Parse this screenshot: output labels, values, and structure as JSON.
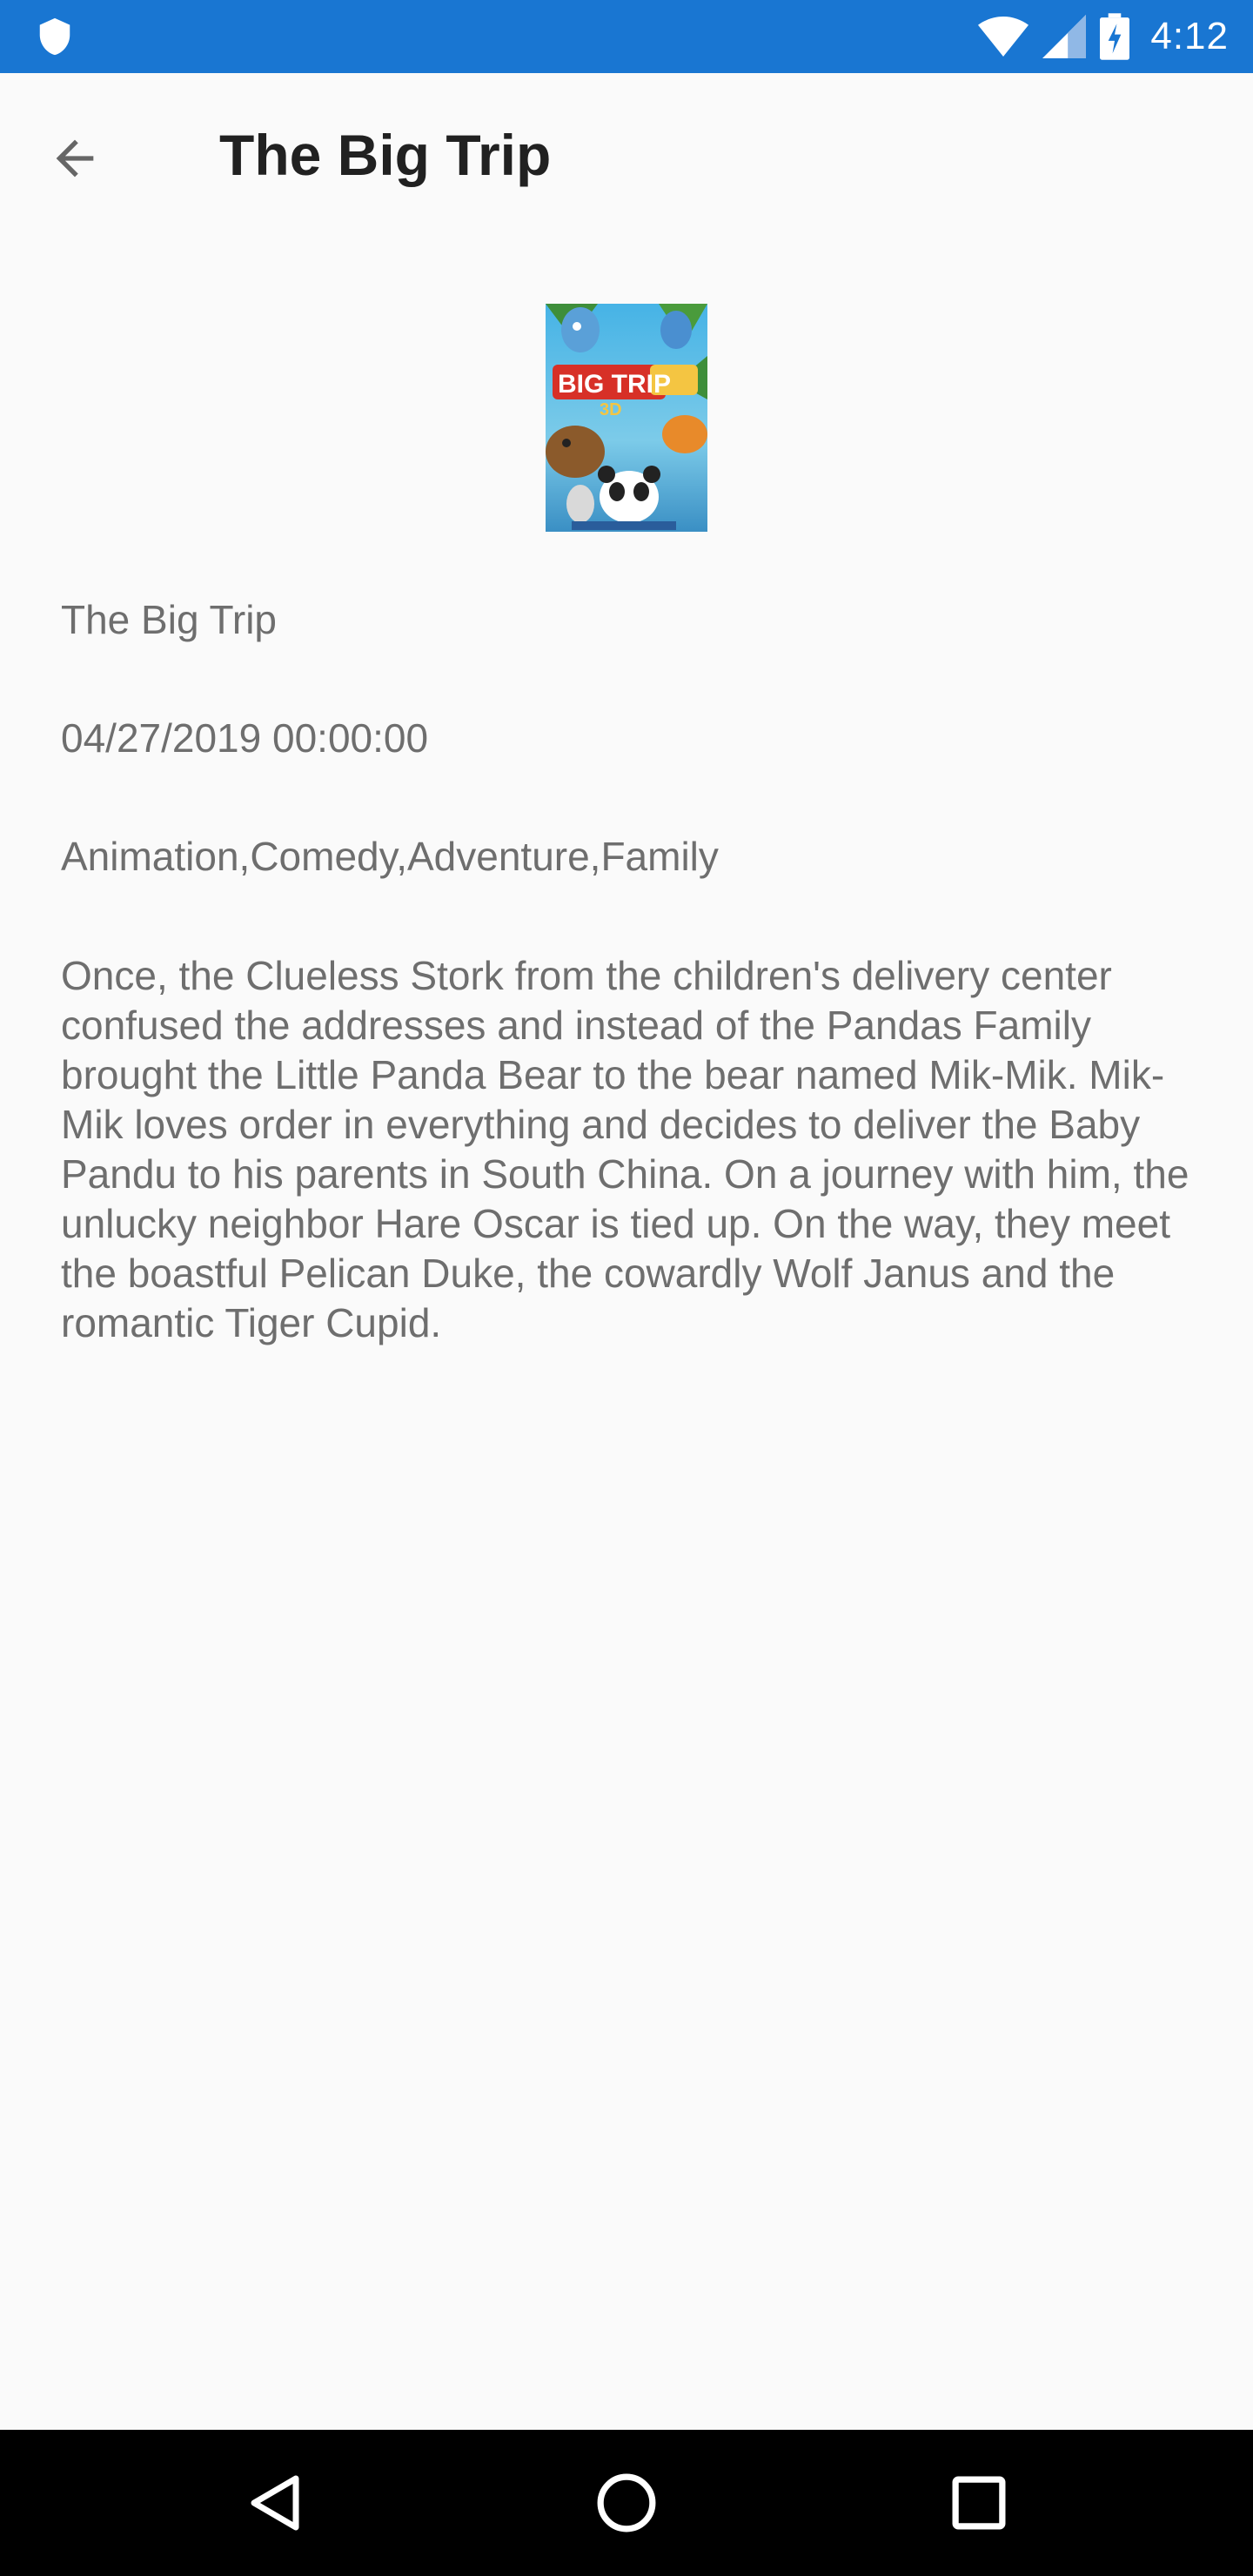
{
  "status_bar": {
    "time": "4:12",
    "icons": [
      "shield-icon",
      "wifi-icon",
      "cell-signal-icon",
      "battery-charging-icon"
    ],
    "background": "#1976d2"
  },
  "app_bar": {
    "title": "The Big Trip",
    "back_icon": "arrow-back-icon"
  },
  "movie": {
    "poster_alt": "movie-poster",
    "title": "The Big Trip",
    "release_date": "04/27/2019 00:00:00",
    "genres": "Animation,Comedy,Adventure,Family",
    "overview": "Once, the Clueless Stork from the children's delivery center confused the addresses and instead of the Pandas Family brought the Little Panda Bear to the bear named Mik-Mik. Mik-Mik loves order in everything and decides to deliver the Baby Pandu to his parents in South China. On a journey with him, the unlucky neighbor Hare Oscar is tied up. On the way, they meet the boastful Pelican Duke, the cowardly Wolf Janus and the romantic Tiger Cupid."
  },
  "nav_bar": {
    "buttons": [
      "back-triangle-icon",
      "home-circle-icon",
      "recents-square-icon"
    ]
  }
}
